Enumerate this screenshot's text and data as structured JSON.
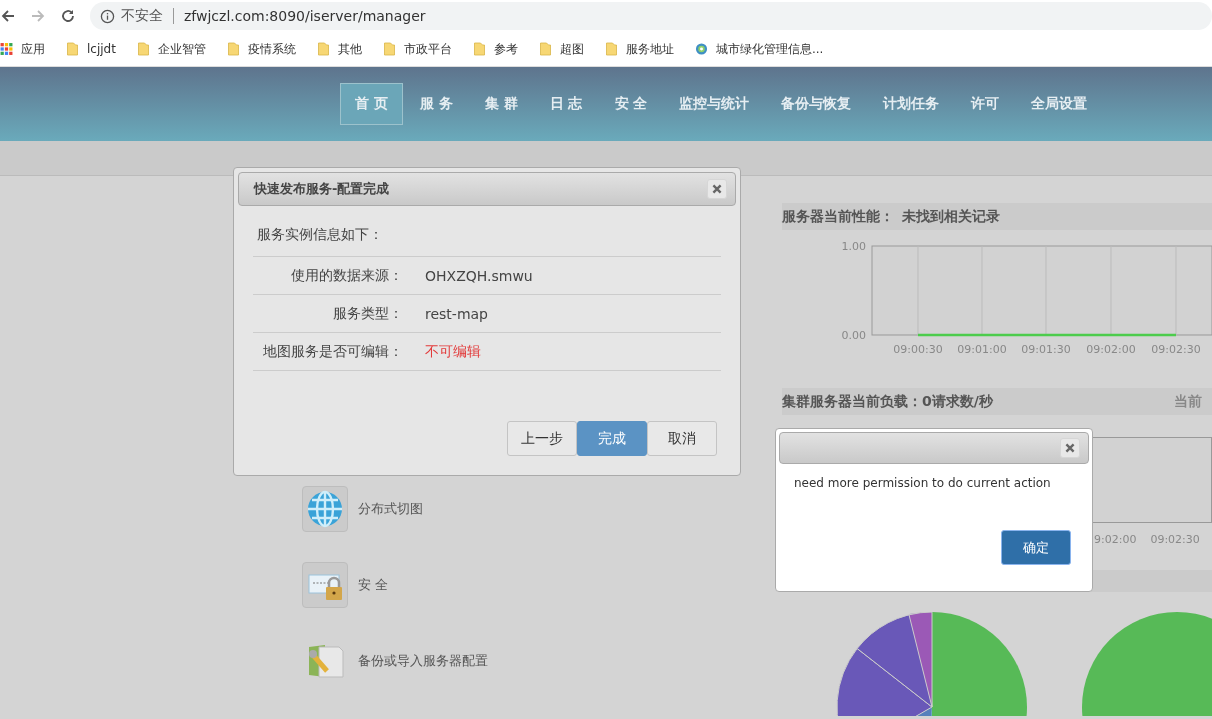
{
  "browser": {
    "security": "不安全",
    "url": "zfwjczl.com:8090/iserver/manager",
    "bookmarks": [
      {
        "label": "应用",
        "kind": "apps"
      },
      {
        "label": "lcjjdt",
        "kind": "folder"
      },
      {
        "label": "企业智管",
        "kind": "folder"
      },
      {
        "label": "疫情系统",
        "kind": "folder"
      },
      {
        "label": "其他",
        "kind": "folder"
      },
      {
        "label": "市政平台",
        "kind": "folder"
      },
      {
        "label": "参考",
        "kind": "folder"
      },
      {
        "label": "超图",
        "kind": "folder"
      },
      {
        "label": "服务地址",
        "kind": "folder"
      },
      {
        "label": "城市绿化管理信息...",
        "kind": "site"
      }
    ]
  },
  "nav": [
    {
      "label": "首 页",
      "selected": true
    },
    {
      "label": "服 务",
      "selected": false
    },
    {
      "label": "集 群",
      "selected": false
    },
    {
      "label": "日 志",
      "selected": false
    },
    {
      "label": "安 全",
      "selected": false
    },
    {
      "label": "监控与统计",
      "selected": false
    },
    {
      "label": "备份与恢复",
      "selected": false
    },
    {
      "label": "计划任务",
      "selected": false
    },
    {
      "label": "许可",
      "selected": false
    },
    {
      "label": "全局设置",
      "selected": false
    }
  ],
  "quick_links": [
    {
      "label": "分布式切图"
    },
    {
      "label": "安 全"
    },
    {
      "label": "备份或导入服务器配置"
    }
  ],
  "performance": {
    "heading": "服务器当前性能：",
    "status": "未找到相关记录",
    "chart_data": {
      "type": "line",
      "categories": [
        "09:00:30",
        "09:01:00",
        "09:01:30",
        "09:02:00",
        "09:02:30"
      ],
      "yticks": [
        {
          "value": 0,
          "label": "0.00"
        },
        {
          "value": 1,
          "label": "1.00"
        }
      ],
      "ylim": [
        0,
        1
      ],
      "grid": true,
      "series": [
        {
          "color": "#4ccc4c",
          "values": [
            0,
            0,
            0,
            0,
            0
          ]
        }
      ]
    }
  },
  "cluster": {
    "heading": "集群服务器当前负载：",
    "load": "0请求数/秒",
    "side_heading": "当前",
    "tick_labels": [
      "9:02:00",
      "09:02:30"
    ]
  },
  "publish_dialog": {
    "title": "快速发布服务-配置完成",
    "intro": "服务实例信息如下：",
    "rows": [
      {
        "label": "使用的数据来源：",
        "value": "OHXZQH.smwu",
        "kind": "normal"
      },
      {
        "label": "服务类型：",
        "value": "rest-map",
        "kind": "normal"
      },
      {
        "label": "地图服务是否可编辑：",
        "value": "不可编辑",
        "kind": "warning"
      }
    ],
    "buttons": [
      {
        "label": "上一步",
        "kind": "default"
      },
      {
        "label": "完成",
        "kind": "primary"
      },
      {
        "label": "取消",
        "kind": "default"
      }
    ]
  },
  "alert_dialog": {
    "message": "need more permission to do current action",
    "button": "确定"
  }
}
